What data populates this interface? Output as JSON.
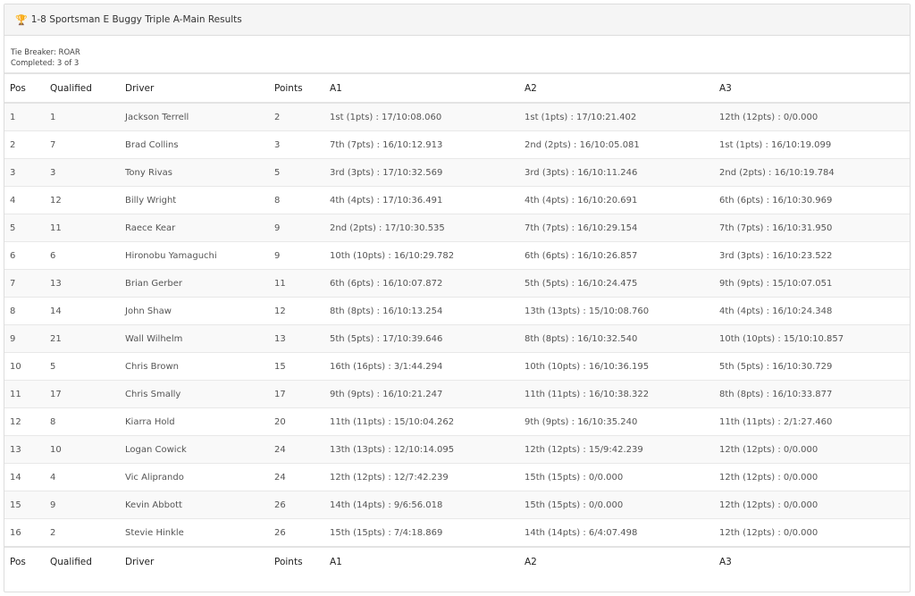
{
  "panel": {
    "title": "1-8 Sportsman E Buggy Triple A-Main Results",
    "icon": "trophy-icon",
    "tie_breaker": "Tie Breaker: ROAR",
    "completed": "Completed: 3 of 3"
  },
  "table": {
    "headers": [
      "Pos",
      "Qualified",
      "Driver",
      "Points",
      "A1",
      "A2",
      "A3"
    ],
    "rows": [
      [
        "1",
        "1",
        "Jackson Terrell",
        "2",
        "1st (1pts) : 17/10:08.060",
        "1st (1pts) : 17/10:21.402",
        "12th (12pts) : 0/0.000"
      ],
      [
        "2",
        "7",
        "Brad Collins",
        "3",
        "7th (7pts) : 16/10:12.913",
        "2nd (2pts) : 16/10:05.081",
        "1st (1pts) : 16/10:19.099"
      ],
      [
        "3",
        "3",
        "Tony Rivas",
        "5",
        "3rd (3pts) : 17/10:32.569",
        "3rd (3pts) : 16/10:11.246",
        "2nd (2pts) : 16/10:19.784"
      ],
      [
        "4",
        "12",
        "Billy Wright",
        "8",
        "4th (4pts) : 17/10:36.491",
        "4th (4pts) : 16/10:20.691",
        "6th (6pts) : 16/10:30.969"
      ],
      [
        "5",
        "11",
        "Raece Kear",
        "9",
        "2nd (2pts) : 17/10:30.535",
        "7th (7pts) : 16/10:29.154",
        "7th (7pts) : 16/10:31.950"
      ],
      [
        "6",
        "6",
        "Hironobu Yamaguchi",
        "9",
        "10th (10pts) : 16/10:29.782",
        "6th (6pts) : 16/10:26.857",
        "3rd (3pts) : 16/10:23.522"
      ],
      [
        "7",
        "13",
        "Brian Gerber",
        "11",
        "6th (6pts) : 16/10:07.872",
        "5th (5pts) : 16/10:24.475",
        "9th (9pts) : 15/10:07.051"
      ],
      [
        "8",
        "14",
        "John Shaw",
        "12",
        "8th (8pts) : 16/10:13.254",
        "13th (13pts) : 15/10:08.760",
        "4th (4pts) : 16/10:24.348"
      ],
      [
        "9",
        "21",
        "Wall Wilhelm",
        "13",
        "5th (5pts) : 17/10:39.646",
        "8th (8pts) : 16/10:32.540",
        "10th (10pts) : 15/10:10.857"
      ],
      [
        "10",
        "5",
        "Chris Brown",
        "15",
        "16th (16pts) : 3/1:44.294",
        "10th (10pts) : 16/10:36.195",
        "5th (5pts) : 16/10:30.729"
      ],
      [
        "11",
        "17",
        "Chris Smally",
        "17",
        "9th (9pts) : 16/10:21.247",
        "11th (11pts) : 16/10:38.322",
        "8th (8pts) : 16/10:33.877"
      ],
      [
        "12",
        "8",
        "Kiarra Hold",
        "20",
        "11th (11pts) : 15/10:04.262",
        "9th (9pts) : 16/10:35.240",
        "11th (11pts) : 2/1:27.460"
      ],
      [
        "13",
        "10",
        "Logan Cowick",
        "24",
        "13th (13pts) : 12/10:14.095",
        "12th (12pts) : 15/9:42.239",
        "12th (12pts) : 0/0.000"
      ],
      [
        "14",
        "4",
        "Vic Aliprando",
        "24",
        "12th (12pts) : 12/7:42.239",
        "15th (15pts) : 0/0.000",
        "12th (12pts) : 0/0.000"
      ],
      [
        "15",
        "9",
        "Kevin Abbott",
        "26",
        "14th (14pts) : 9/6:56.018",
        "15th (15pts) : 0/0.000",
        "12th (12pts) : 0/0.000"
      ],
      [
        "16",
        "2",
        "Stevie Hinkle",
        "26",
        "15th (15pts) : 7/4:18.869",
        "14th (14pts) : 6/4:07.498",
        "12th (12pts) : 0/0.000"
      ]
    ]
  }
}
